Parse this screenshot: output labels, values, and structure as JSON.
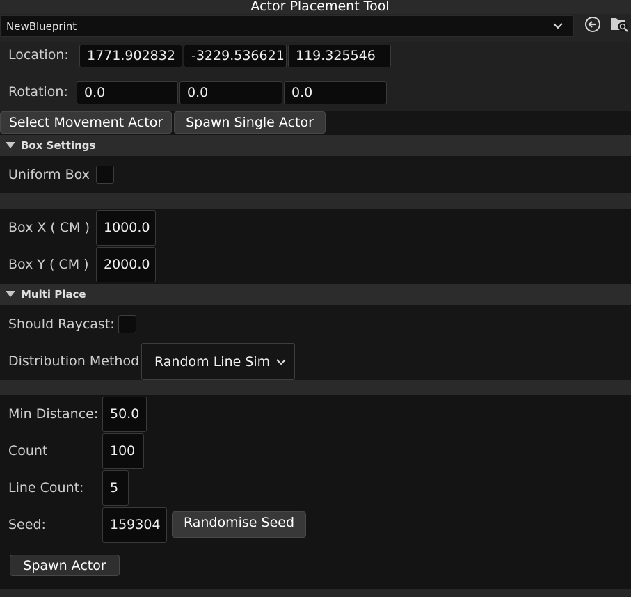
{
  "window": {
    "title": "Actor Placement Tool"
  },
  "asset_picker": {
    "selected": "NewBlueprint",
    "use_icon": "arrow-left-circle-icon",
    "browse_icon": "folder-search-icon"
  },
  "transform": {
    "location_label": "Location:",
    "location": [
      "1771.902832",
      "-3229.536621",
      "119.325546"
    ],
    "rotation_label": "Rotation:",
    "rotation": [
      "0.0",
      "0.0",
      "0.0"
    ]
  },
  "actions": {
    "select_movement": "Select Movement Actor",
    "spawn_single": "Spawn Single Actor"
  },
  "box_settings": {
    "header": "Box Settings",
    "uniform_label": "Uniform Box",
    "uniform_checked": false,
    "box_x_label": "Box X ( CM )",
    "box_x": "1000.0",
    "box_y_label": "Box Y ( CM )",
    "box_y": "2000.0"
  },
  "multi_place": {
    "header": "Multi Place",
    "raycast_label": "Should Raycast:",
    "raycast_checked": false,
    "distribution_label": "Distribution Method",
    "distribution_value": "Random Line Sim",
    "min_distance_label": "Min Distance:",
    "min_distance": "50.0",
    "count_label": "Count",
    "count": "100",
    "line_count_label": "Line Count:",
    "line_count": "5",
    "seed_label": "Seed:",
    "seed": "159304",
    "randomise_seed": "Randomise Seed",
    "spawn_actor": "Spawn Actor"
  },
  "colors": {
    "panel": "#1c1c1c",
    "field": "#0b0b0b",
    "button": "#383838",
    "header": "#2c2c2c"
  }
}
